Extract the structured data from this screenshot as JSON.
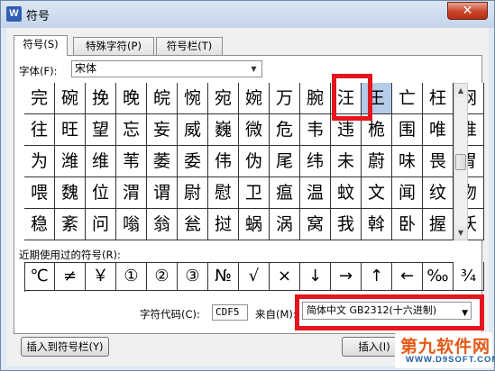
{
  "window": {
    "title": "符号",
    "app_icon": "W",
    "close_label": "✕"
  },
  "tabs": [
    {
      "label": "符号(S)",
      "active": true
    },
    {
      "label": "特殊字符(P)",
      "active": false
    },
    {
      "label": "符号栏(T)",
      "active": false
    }
  ],
  "font": {
    "label": "字体(F):",
    "value": "宋体"
  },
  "symbols": [
    [
      "完",
      "碗",
      "挽",
      "晚",
      "皖",
      "惋",
      "宛",
      "婉",
      "万",
      "腕",
      "汪",
      "王",
      "亡",
      "枉",
      "网"
    ],
    [
      "往",
      "旺",
      "望",
      "忘",
      "妄",
      "威",
      "巍",
      "微",
      "危",
      "韦",
      "违",
      "桅",
      "围",
      "唯",
      "惟"
    ],
    [
      "为",
      "潍",
      "维",
      "苇",
      "萎",
      "委",
      "伟",
      "伪",
      "尾",
      "纬",
      "未",
      "蔚",
      "味",
      "畏",
      "胃"
    ],
    [
      "喂",
      "魏",
      "位",
      "渭",
      "谓",
      "尉",
      "慰",
      "卫",
      "瘟",
      "温",
      "蚊",
      "文",
      "闻",
      "纹",
      "吻"
    ],
    [
      "稳",
      "紊",
      "问",
      "嗡",
      "翁",
      "瓮",
      "挝",
      "蜗",
      "涡",
      "窝",
      "我",
      "斡",
      "卧",
      "握",
      "沃"
    ]
  ],
  "selected_symbol": "王",
  "recent": {
    "label": "近期使用过的符号(R):",
    "symbols": [
      "℃",
      "≠",
      "￥",
      "①",
      "②",
      "③",
      "№",
      "√",
      "×",
      "↓",
      "→",
      "↑",
      "←",
      "‰",
      "¾"
    ]
  },
  "char_code": {
    "label": "字符代码(C):",
    "value": "CDF5"
  },
  "from": {
    "label": "来自(M):",
    "value": "简体中文 GB2312(十六进制)"
  },
  "buttons": {
    "insert_to_bar": "插入到符号栏(Y)",
    "insert": "插入(I)"
  },
  "watermark": {
    "main": "第九软件网",
    "sub": "WWW.D9SOFT.COM"
  },
  "colors": {
    "highlight": "#e3151d",
    "selection": "#b5cbe8"
  }
}
